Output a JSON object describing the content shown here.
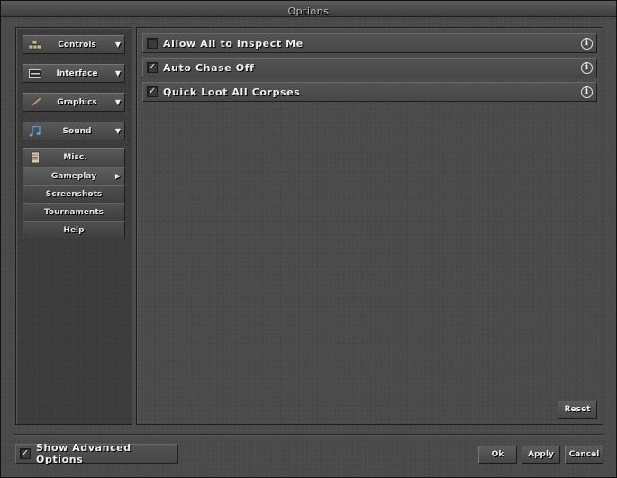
{
  "window": {
    "title": "Options"
  },
  "sidebar": {
    "categories": [
      {
        "label": "Controls",
        "icon": "controls-icon"
      },
      {
        "label": "Interface",
        "icon": "interface-icon"
      },
      {
        "label": "Graphics",
        "icon": "brush-icon"
      },
      {
        "label": "Sound",
        "icon": "music-note-icon"
      }
    ],
    "misc": {
      "label": "Misc.",
      "icon": "scroll-icon",
      "items": [
        {
          "label": "Gameplay",
          "selected": true
        },
        {
          "label": "Screenshots"
        },
        {
          "label": "Tournaments"
        },
        {
          "label": "Help"
        }
      ]
    }
  },
  "options": [
    {
      "label": "Allow All to Inspect Me",
      "checked": false,
      "checkmark": ""
    },
    {
      "label": "Auto Chase Off",
      "checked": true,
      "checkmark": "✓"
    },
    {
      "label": "Quick Loot All Corpses",
      "checked": true,
      "checkmark": "✓"
    }
  ],
  "buttons": {
    "reset": "Reset",
    "ok": "Ok",
    "apply": "Apply",
    "cancel": "Cancel"
  },
  "advanced": {
    "label": "Show Advanced Options",
    "checked": true,
    "checkmark": "✓"
  },
  "glyphs": {
    "dropdown": "▼",
    "submenu": "▶",
    "info": "i"
  }
}
